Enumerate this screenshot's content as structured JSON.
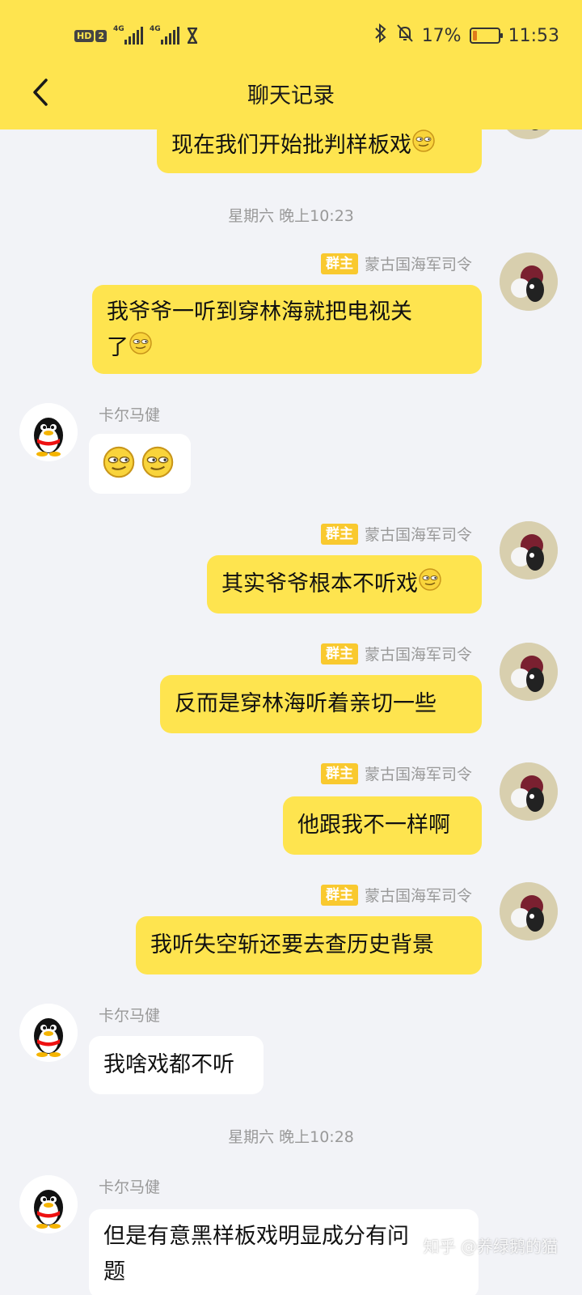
{
  "status_bar": {
    "hd_label": "HD",
    "hd_number": "2",
    "network_1": "4G",
    "network_2": "4G",
    "battery_percent": "17%",
    "battery_level": 0.17,
    "time": "11:53"
  },
  "header": {
    "title": "聊天记录",
    "accent_color": "#fee44f"
  },
  "messages": {
    "top_partial": {
      "text": "现在我们开始批判样板戏"
    },
    "time_1": "星期六 晚上10:23",
    "m1": {
      "badge": "群主",
      "sender": "蒙古国海军司令",
      "line1": "我爷爷一听到穿林海就把电视关",
      "line2": "了"
    },
    "m2": {
      "sender": "卡尔马健"
    },
    "m3": {
      "badge": "群主",
      "sender": "蒙古国海军司令",
      "text": "其实爷爷根本不听戏"
    },
    "m4": {
      "badge": "群主",
      "sender": "蒙古国海军司令",
      "text": "反而是穿林海听着亲切一些"
    },
    "m5": {
      "badge": "群主",
      "sender": "蒙古国海军司令",
      "text": "他跟我不一样啊"
    },
    "m6": {
      "badge": "群主",
      "sender": "蒙古国海军司令",
      "text": "我听失空斩还要去查历史背景"
    },
    "m7": {
      "sender": "卡尔马健",
      "text": "我啥戏都不听"
    },
    "time_2": "星期六 晚上10:28",
    "m8": {
      "sender": "卡尔马健",
      "line1": "但是有意黑样板戏明显成分有问",
      "line2": "题"
    }
  },
  "watermark": "知乎 @养绿鹅的猫"
}
